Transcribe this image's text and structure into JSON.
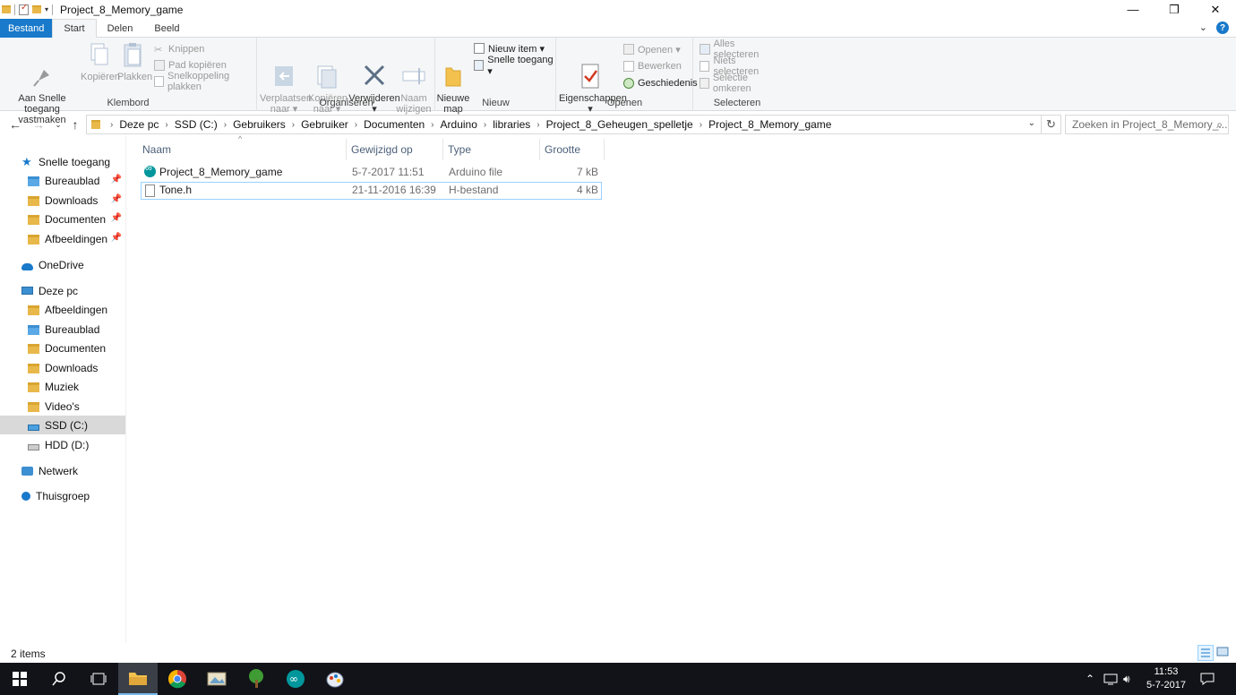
{
  "window": {
    "title": "Project_8_Memory_game",
    "minimize": "—",
    "maximize": "❐",
    "close": "✕"
  },
  "ribbon_tabs": {
    "file": "Bestand",
    "items": [
      "Start",
      "Delen",
      "Beeld"
    ]
  },
  "ribbon": {
    "groups": {
      "klembord": "Klembord",
      "organiseren": "Organiseren",
      "nieuw": "Nieuw",
      "openen": "Openen",
      "selecteren": "Selecteren"
    },
    "pin_quick_access": "Aan Snelle toegang\nvastmaken",
    "copy": "Kopiëren",
    "paste": "Plakken",
    "cut": "Knippen",
    "copy_path": "Pad kopiëren",
    "paste_shortcut": "Snelkoppeling plakken",
    "move_to": "Verplaatsen\nnaar ▾",
    "copy_to": "Kopiëren\nnaar ▾",
    "delete": "Verwijderen\n▾",
    "rename": "Naam\nwijzigen",
    "new_folder": "Nieuwe\nmap",
    "new_item": "Nieuw item ▾",
    "easy_access": "Snelle toegang ▾",
    "properties": "Eigenschappen\n▾",
    "open": "Openen ▾",
    "edit": "Bewerken",
    "history": "Geschiedenis",
    "select_all": "Alles selecteren",
    "select_none": "Niets selecteren",
    "invert_selection": "Selectie omkeren"
  },
  "address": {
    "crumbs": [
      "Deze pc",
      "SSD (C:)",
      "Gebruikers",
      "Gebruiker",
      "Documenten",
      "Arduino",
      "libraries",
      "Project_8_Geheugen_spelletje",
      "Project_8_Memory_game"
    ],
    "search_placeholder": "Zoeken in Project_8_Memory_..."
  },
  "navigation": {
    "quick_access": "Snelle toegang",
    "quick_items": [
      "Bureaublad",
      "Downloads",
      "Documenten",
      "Afbeeldingen"
    ],
    "onedrive": "OneDrive",
    "this_pc": "Deze pc",
    "pc_items": [
      "Afbeeldingen",
      "Bureaublad",
      "Documenten",
      "Downloads",
      "Muziek",
      "Video's",
      "SSD (C:)",
      "HDD (D:)"
    ],
    "network": "Netwerk",
    "homegroup": "Thuisgroep"
  },
  "columns": {
    "name": "Naam",
    "modified": "Gewijzigd op",
    "type": "Type",
    "size": "Grootte"
  },
  "files": [
    {
      "name": "Project_8_Memory_game",
      "modified": "5-7-2017 11:51",
      "type": "Arduino file",
      "size": "7 kB"
    },
    {
      "name": "Tone.h",
      "modified": "21-11-2016 16:39",
      "type": "H-bestand",
      "size": "4 kB"
    }
  ],
  "status": {
    "count": "2 items"
  },
  "clock": {
    "time": "11:53",
    "date": "5-7-2017"
  },
  "colors": {
    "accent": "#1979ca",
    "selection": "#d9d9d9",
    "taskbar": "#111318"
  }
}
